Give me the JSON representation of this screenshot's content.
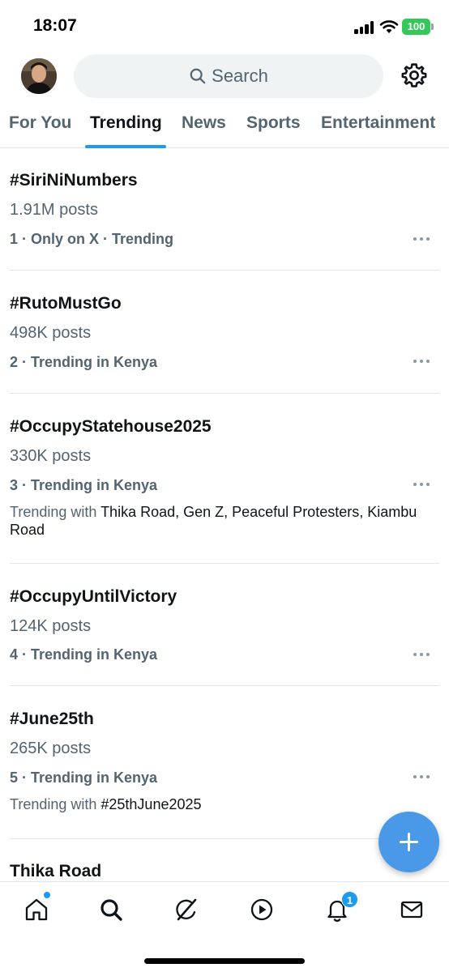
{
  "status_bar": {
    "time": "18:07",
    "battery": "100"
  },
  "header": {
    "search_placeholder": "Search",
    "avatar_icon": "profile-avatar",
    "settings_icon": "gear-icon"
  },
  "tabs": [
    {
      "label": "For You",
      "active": false
    },
    {
      "label": "Trending",
      "active": true
    },
    {
      "label": "News",
      "active": false
    },
    {
      "label": "Sports",
      "active": false
    },
    {
      "label": "Entertainment",
      "active": false
    }
  ],
  "trends": [
    {
      "title": "#SiriNiNumbers",
      "count": "1.91M posts",
      "meta": "1 · Only on X · Trending"
    },
    {
      "title": "#RutoMustGo",
      "count": "498K posts",
      "meta": "2 · Trending in Kenya"
    },
    {
      "title": "#OccupyStatehouse2025",
      "count": "330K posts",
      "meta": "3 · Trending in Kenya",
      "with_prefix": "Trending with ",
      "with_topics": "Thika Road, Gen Z, Peaceful Protesters, Kiambu Road"
    },
    {
      "title": "#OccupyUntilVictory",
      "count": "124K posts",
      "meta": "4 · Trending in Kenya"
    },
    {
      "title": "#June25th",
      "count": "265K posts",
      "meta": "5 · Trending in Kenya",
      "with_prefix": "Trending with ",
      "with_topics": "#25thJune2025"
    },
    {
      "title": "Thika Road"
    }
  ],
  "bottom_nav": {
    "items": [
      {
        "icon": "home-icon",
        "has_dot": true
      },
      {
        "icon": "search-icon"
      },
      {
        "icon": "grok-icon"
      },
      {
        "icon": "video-icon"
      },
      {
        "icon": "bell-icon",
        "badge": "1"
      },
      {
        "icon": "mail-icon"
      }
    ]
  },
  "colors": {
    "accent": "#1d9bf0",
    "fab": "#4a99e9",
    "secondary_text": "#536471",
    "battery": "#34c759"
  }
}
